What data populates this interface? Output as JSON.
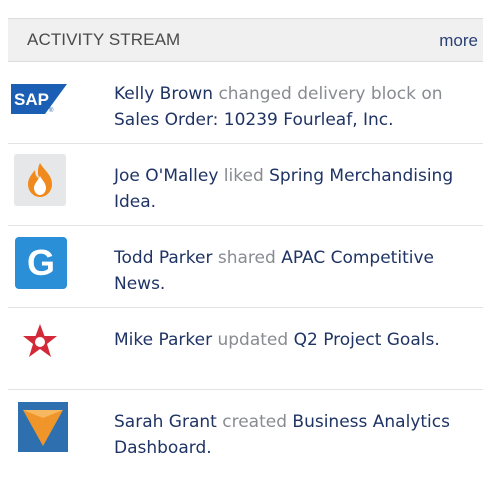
{
  "header": {
    "title": "ACTIVITY STREAM",
    "more": "more"
  },
  "items": [
    {
      "actor": "Kelly Brown",
      "verb": "changed delivery block on",
      "target": "Sales Order: 10239 Fourleaf, Inc.",
      "icon": "sap-icon"
    },
    {
      "actor": "Joe O'Malley",
      "verb": "liked",
      "target": "Spring Merchandising Idea.",
      "icon": "flame-icon"
    },
    {
      "actor": "Todd Parker",
      "verb": "shared",
      "target": "APAC Competitive News.",
      "icon": "g-icon"
    },
    {
      "actor": "Mike Parker",
      "verb": "updated",
      "target": "Q2 Project Goals.",
      "icon": "star-icon"
    },
    {
      "actor": "Sarah Grant",
      "verb": "created",
      "target": "Business Analytics Dashboard.",
      "icon": "funnel-icon"
    }
  ],
  "colors": {
    "link": "#1f3464",
    "verb": "#888b91",
    "header_bg": "#f0f0f0",
    "sap_blue": "#1a5fb4",
    "flame_orange": "#f08a1e",
    "g_blue": "#2a8fd6",
    "star_red": "#d32a3a",
    "funnel_orange": "#f0952a",
    "funnel_bg": "#2e6fb0"
  }
}
